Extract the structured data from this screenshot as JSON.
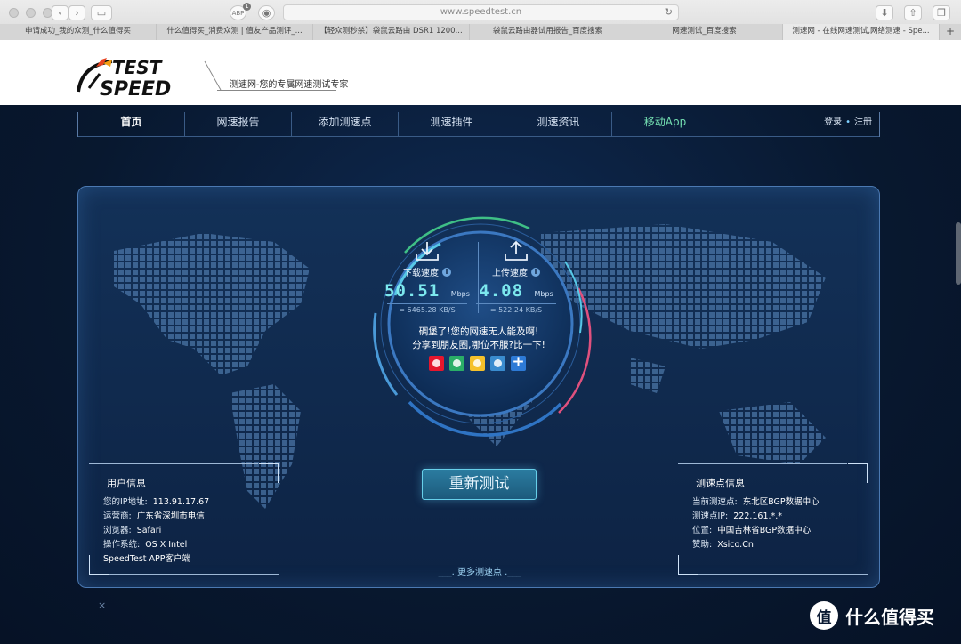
{
  "browser": {
    "url": "www.speedtest.cn",
    "adblock_badge": "1",
    "tabs": [
      "申请成功_我的众测_什么值得买",
      "什么值得买_消费众测 | 值友产品测评_...",
      "【轻众测秒杀】袋鼠云路由 DSR1 1200...",
      "袋鼠云路由器试用报告_百度搜索",
      "网速测试_百度搜索",
      "测速网 - 在线网速测试,网络测速 - Spe..."
    ],
    "new_tab": "+"
  },
  "site": {
    "logo_text_1": "TEST",
    "logo_text_2": "SPEED",
    "tagline": "测速网-您的专属网速测试专家"
  },
  "nav": {
    "items": [
      "首页",
      "网速报告",
      "添加测速点",
      "测速插件",
      "测速资讯",
      "移动App"
    ],
    "login": "登录",
    "dot": "•",
    "register": "注册"
  },
  "result": {
    "download": {
      "label": "下载速度",
      "value": "50.51",
      "unit": "Mbps",
      "kbs": "= 6465.28  KB/S"
    },
    "upload": {
      "label": "上传速度",
      "value": "4.08",
      "unit": "Mbps",
      "kbs": "= 522.24  KB/S"
    },
    "info_glyph": "i",
    "message_1": "碉堡了!您的网速无人能及啊!",
    "message_2": "分享到朋友圈,哪位不服?比一下!",
    "retest": "重新测试",
    "more_points": "___. 更多测速点 .___"
  },
  "user_info": {
    "title": "用户信息",
    "rows": [
      {
        "k": "您的IP地址:",
        "v": "113.91.17.67"
      },
      {
        "k": "运营商:",
        "v": "广东省深圳市电信"
      },
      {
        "k": "浏览器:",
        "v": "Safari"
      },
      {
        "k": "操作系统:",
        "v": "OS X Intel"
      }
    ],
    "app_link": "SpeedTest APP客户端"
  },
  "server_info": {
    "title": "测速点信息",
    "rows": [
      {
        "k": "当前测速点:",
        "v": "东北区BGP数据中心"
      },
      {
        "k": "测速点IP:",
        "v": "222.161.*.*"
      },
      {
        "k": "位置:",
        "v": "中国吉林省BGP数据中心"
      },
      {
        "k": "赞助:",
        "v": "Xsico.Cn"
      }
    ]
  },
  "close_glyph": "×",
  "watermark": "什么值得买",
  "colors": {
    "accent_speed": "#7ce8ee",
    "nav_app": "#74e0b2",
    "panel_border": "#4b79b2"
  }
}
